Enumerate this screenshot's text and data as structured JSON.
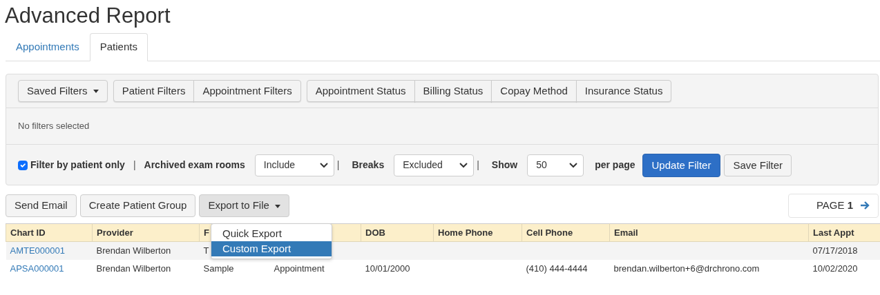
{
  "title": "Advanced Report",
  "tabs": [
    {
      "label": "Appointments",
      "selected": false
    },
    {
      "label": "Patients",
      "selected": true
    }
  ],
  "filter_panel": {
    "button_groups": [
      [
        {
          "label": "Saved Filters",
          "dropdown": true
        }
      ],
      [
        {
          "label": "Patient Filters",
          "dropdown": false
        },
        {
          "label": "Appointment Filters",
          "dropdown": false
        }
      ],
      [
        {
          "label": "Appointment Status",
          "dropdown": false
        },
        {
          "label": "Billing Status",
          "dropdown": false
        },
        {
          "label": "Copay Method",
          "dropdown": false
        },
        {
          "label": "Insurance Status",
          "dropdown": false
        }
      ]
    ],
    "summary": "No filters selected",
    "options": [
      {
        "kind": "checkbox",
        "label": "Filter by patient only",
        "checked": true
      },
      {
        "kind": "select",
        "label": "Archived exam rooms",
        "value": "Include"
      },
      {
        "kind": "select",
        "label": "Breaks",
        "value": "Excluded"
      },
      {
        "kind": "select",
        "label": "Show",
        "value": "50",
        "suffix": "per page"
      }
    ],
    "separator": "|",
    "primary_button": "Update Filter",
    "secondary_button": "Save Filter"
  },
  "actions": [
    {
      "label": "Send Email",
      "dropdown": false
    },
    {
      "label": "Create Patient Group",
      "dropdown": false
    },
    {
      "label": "Export to File",
      "dropdown": true
    }
  ],
  "export_menu": [
    {
      "label": "Quick Export",
      "selected": false
    },
    {
      "label": "Custom Export",
      "selected": true
    }
  ],
  "pager": {
    "label": "PAGE",
    "number": "1"
  },
  "table": {
    "columns": [
      "Chart ID",
      "Provider",
      "F",
      "",
      "DOB",
      "Home Phone",
      "Cell Phone",
      "Email",
      "Last Appt"
    ],
    "rows": [
      [
        "AMTE000001",
        "Brendan Wilberton",
        "T",
        "",
        "",
        "",
        "",
        "",
        "07/17/2018"
      ],
      [
        "APSA000001",
        "Brendan Wilberton",
        "Sample",
        "Appointment",
        "10/01/2000",
        "",
        "(410) 444-4444",
        "brendan.wilberton+6@drchrono.com",
        "10/02/2020"
      ]
    ]
  }
}
